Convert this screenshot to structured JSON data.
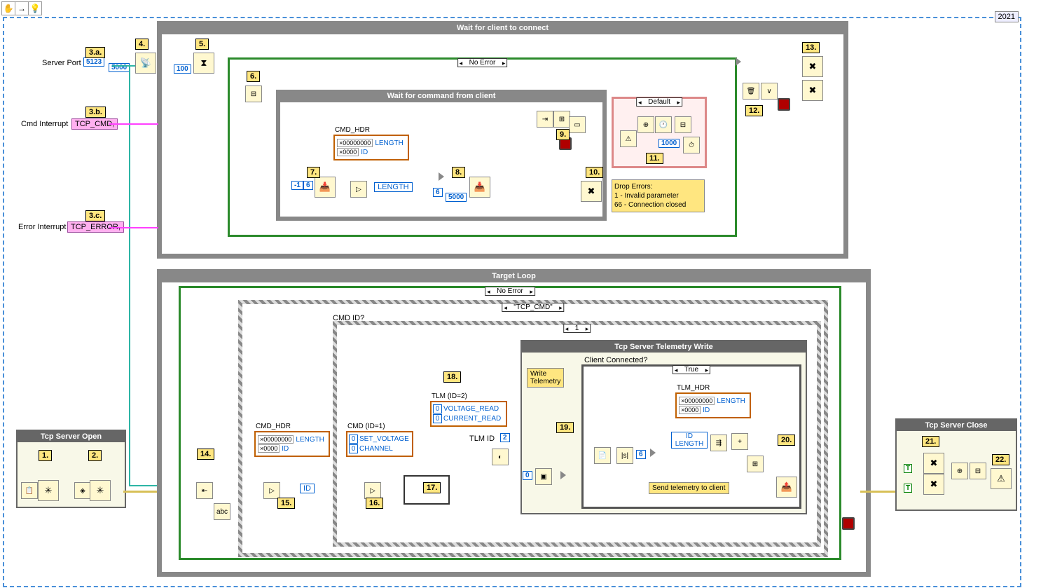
{
  "year": "2021",
  "labels": {
    "server_port": "Server Port",
    "cmd_interrupt": "Cmd Interrupt",
    "error_interrupt": "Error Interrupt",
    "tcp_cmd": "TCP_CMD,",
    "tcp_error": "TCP_ERROR,"
  },
  "constants": {
    "port": "5123",
    "timeout5000a": "5000",
    "hundred": "100",
    "neg1": "-1",
    "six_a": "6",
    "timeout5000b": "5000",
    "thousand": "1000",
    "six_b": "6",
    "tlm_id": "2",
    "zero_idx": "0",
    "t_a": "T",
    "t_b": "T"
  },
  "callouts": {
    "c1": "1.",
    "c2": "2.",
    "c3a": "3.a.",
    "c3b": "3.b.",
    "c3c": "3.c.",
    "c4": "4.",
    "c5": "5.",
    "c6": "6.",
    "c7": "7.",
    "c8": "8.",
    "c9": "9.",
    "c10": "10.",
    "c11": "11.",
    "c12": "12.",
    "c13": "13.",
    "c14": "14.",
    "c15": "15.",
    "c16": "16.",
    "c17": "17.",
    "c18": "18.",
    "c19": "19.",
    "c20": "20.",
    "c21": "21.",
    "c22": "22."
  },
  "loops": {
    "l1_title": "Wait for client to connect",
    "l2_title": "Wait for command from client",
    "l3_title": "Target Loop"
  },
  "cases": {
    "no_error_a": "No Error",
    "default": "Default",
    "no_error_b": "No Error",
    "tcp_cmd": "\"TCP_CMD\"",
    "one": "1",
    "true": "True"
  },
  "clusters": {
    "cmd_hdr": {
      "title": "CMD_HDR",
      "length_val": "×00000000",
      "length_name": "LENGTH",
      "id_val": "×0000",
      "id_name": "ID"
    },
    "tlm_hdr": {
      "title": "TLM_HDR",
      "length_val": "×00000000",
      "length_name": "LENGTH",
      "id_val": "×0000",
      "id_name": "ID"
    }
  },
  "enums": {
    "cmd": {
      "title": "CMD (ID=1)",
      "i0": "0",
      "n0": "SET_VOLTAGE",
      "i1": "0",
      "n1": "CHANNEL"
    },
    "tlm": {
      "title": "TLM (ID=2)",
      "i0": "0",
      "n0": "VOLTAGE_READ",
      "i1": "0",
      "n1": "CURRENT_READ"
    }
  },
  "subvis": {
    "open": "Tcp Server Open",
    "close": "Tcp Server Close",
    "tlm_write": "Tcp Server Telemetry Write"
  },
  "texts": {
    "length_field": "LENGTH",
    "id_field": "ID",
    "length_field2": "LENGTH",
    "cmd_id_q": "CMD ID?",
    "tlm_id": "TLM ID",
    "client_connected": "Client Connected?",
    "write_tlm": "Write\nTelemetry",
    "send_tlm": "Send telemetry to client"
  },
  "comment": {
    "title": "Drop Errors:",
    "line1": "1 - Invalid parameter",
    "line2": "66 - Connection closed"
  }
}
